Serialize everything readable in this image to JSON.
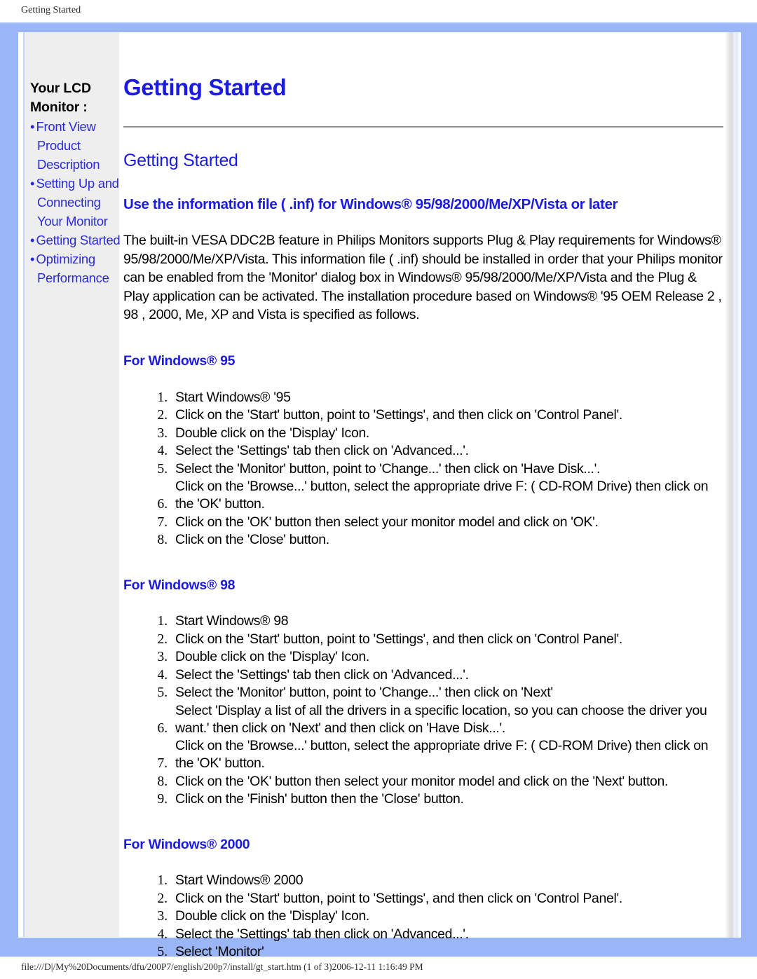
{
  "print": {
    "header": "Getting Started",
    "footer": "file:///D|/My%20Documents/dfu/200P7/english/200p7/install/gt_start.htm (1 of 3)2006-12-11 1:16:49 PM"
  },
  "colors": {
    "frame_blue": "#9ab6f6",
    "sidebar_bg": "#eeeeee",
    "link_blue": "#2a2ae0",
    "heading_blue": "#1a1ae0",
    "body_text": "#000000"
  },
  "sidebar": {
    "title": "Your LCD Monitor :",
    "items": [
      {
        "bullet": "•",
        "label": "Front View Product Description"
      },
      {
        "bullet": "•",
        "label": "Setting Up and Connecting Your Monitor"
      },
      {
        "bullet": "•",
        "label": "Getting Started"
      },
      {
        "bullet": "•",
        "label": "Optimizing Performance"
      }
    ]
  },
  "main": {
    "page_title": "Getting Started",
    "section_title": "Getting Started",
    "section_heading": "Use the information file ( .inf) for Windows® 95/98/2000/Me/XP/Vista or later",
    "intro": "The built-in VESA DDC2B feature in Philips Monitors supports Plug & Play requirements for Windows® 95/98/2000/Me/XP/Vista. This information file ( .inf) should be installed in order that your Philips monitor can be enabled from the 'Monitor' dialog box in Windows® 95/98/2000/Me/XP/Vista and the Plug & Play application can be activated. The installation procedure based on Windows® '95 OEM Release 2 , 98 , 2000, Me, XP and Vista is specified as follows.",
    "os_sections": [
      {
        "heading": "For Windows® 95",
        "steps": [
          "Start Windows® '95",
          "Click on the 'Start' button, point to 'Settings', and then click on 'Control Panel'.",
          "Double click on the 'Display' Icon.",
          "Select the 'Settings' tab then click on 'Advanced...'.",
          "Select the 'Monitor' button, point to 'Change...' then click on 'Have Disk...'.",
          "Click on the 'Browse...' button, select the appropriate drive F: ( CD-ROM Drive) then click on the 'OK' button.",
          "Click on the 'OK' button then select your monitor model and click on 'OK'.",
          "Click on the 'Close' button."
        ]
      },
      {
        "heading": "For Windows® 98",
        "steps": [
          "Start Windows® 98",
          "Click on the 'Start' button, point to 'Settings', and then click on 'Control Panel'.",
          "Double click on the 'Display' Icon.",
          "Select the 'Settings' tab then click on 'Advanced...'.",
          "Select the 'Monitor' button, point to 'Change...' then click on 'Next'",
          "Select 'Display a list of all the drivers in a specific location, so you can choose the driver you want.' then click on 'Next' and then click on 'Have Disk...'.",
          "Click on the 'Browse...' button, select the appropriate drive F: ( CD-ROM Drive) then click on the 'OK' button.",
          "Click on the 'OK' button then select your monitor model and click on the 'Next' button.",
          "Click on the 'Finish' button then the 'Close' button."
        ]
      },
      {
        "heading": "For Windows® 2000",
        "steps": [
          "Start Windows® 2000",
          "Click on the 'Start' button, point to 'Settings', and then click on 'Control Panel'.",
          "Double click on the 'Display' Icon.",
          "Select the 'Settings' tab then click on 'Advanced...'.",
          "Select 'Monitor'"
        ]
      }
    ]
  }
}
